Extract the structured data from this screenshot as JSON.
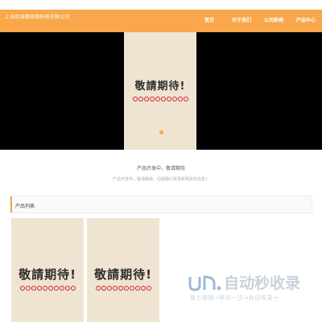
{
  "header": {
    "company_name": "上海欣诺顺网络科技有限公司",
    "nav": [
      "首页",
      "关于我们",
      "公司新闻",
      "产品中心"
    ]
  },
  "banner": {
    "poster_text": "敬請期待!"
  },
  "intro": {
    "title": "产品开发中，敬请期待",
    "subtitle": "产品开发中，敬请期待，后期我们将更新相关的信息！"
  },
  "products": {
    "section_title": "产品列表",
    "items": [
      {
        "poster_text": "敬請期待!"
      },
      {
        "poster_text": "敬請期待!"
      }
    ]
  },
  "watermark": {
    "title": "自动秒收录",
    "subtitle": "做上链接→来访一次→自动收录→"
  },
  "colors": {
    "accent": "#f9a74a",
    "banner_bg": "#000000",
    "poster_bg": "#efe4d2"
  }
}
